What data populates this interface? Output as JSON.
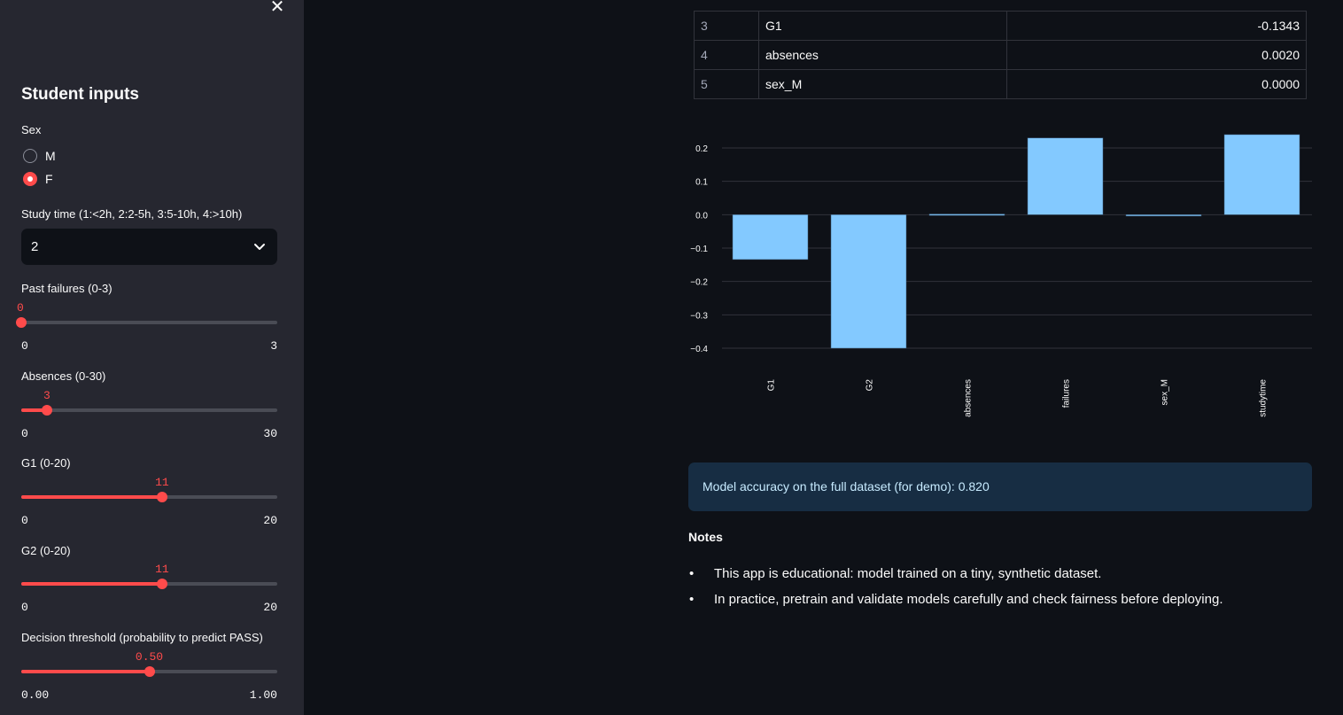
{
  "sidebar": {
    "close_icon": "close-icon",
    "title": "Student inputs",
    "sex": {
      "label": "Sex",
      "options": [
        "M",
        "F"
      ],
      "selected": "F"
    },
    "study_time": {
      "label": "Study time (1:<2h, 2:2-5h, 3:5-10h, 4:>10h)",
      "value": "2"
    },
    "failures": {
      "label": "Past failures (0-3)",
      "value": "0",
      "min": "0",
      "max": "3",
      "fraction": 0.0
    },
    "absences": {
      "label": "Absences (0-30)",
      "value": "3",
      "min": "0",
      "max": "30",
      "fraction": 0.1
    },
    "g1": {
      "label": "G1 (0-20)",
      "value": "11",
      "min": "0",
      "max": "20",
      "fraction": 0.55
    },
    "g2": {
      "label": "G2 (0-20)",
      "value": "11",
      "min": "0",
      "max": "20",
      "fraction": 0.55
    },
    "threshold": {
      "label": "Decision threshold (probability to predict PASS)",
      "value": "0.50",
      "min": "0.00",
      "max": "1.00",
      "fraction": 0.5
    }
  },
  "coef_table": {
    "rows": [
      {
        "index": "3",
        "feature": "G1",
        "value": "-0.1343"
      },
      {
        "index": "4",
        "feature": "absences",
        "value": "0.0020"
      },
      {
        "index": "5",
        "feature": "sex_M",
        "value": "0.0000"
      }
    ]
  },
  "chart_data": {
    "type": "bar",
    "categories": [
      "G1",
      "G2",
      "absences",
      "failures",
      "sex_M",
      "studytime"
    ],
    "values": [
      -0.1343,
      -0.4,
      0.002,
      0.23,
      0.0,
      0.24
    ],
    "ylim": [
      -0.4,
      0.2
    ],
    "yticks": [
      "0.2",
      "0.1",
      "0.0",
      "−0.1",
      "−0.2",
      "−0.3",
      "−0.4"
    ],
    "bar_color": "#83c9ff",
    "grid": true
  },
  "info": {
    "text": "Model accuracy on the full dataset (for demo): 0.820"
  },
  "notes": {
    "heading": "Notes",
    "items": [
      "This app is educational: model trained on a tiny, synthetic dataset.",
      "In practice, pretrain and validate models carefully and check fairness before deploying."
    ]
  },
  "colors": {
    "accent": "#ff4b4b",
    "sidebar_bg": "#262730",
    "main_bg": "#0e1117",
    "info_bg": "#172d43",
    "bar": "#83c9ff"
  }
}
